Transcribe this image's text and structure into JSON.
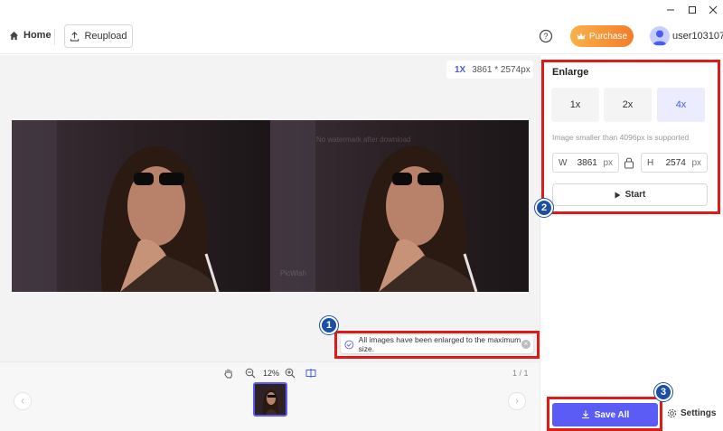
{
  "header": {
    "home_label": "Home",
    "reupload_label": "Reupload",
    "purchase_label": "Purchase",
    "username": "user103107"
  },
  "canvas": {
    "zoom_chip": "1X",
    "size_chip": "3861 * 2574px",
    "watermark_brand": "PicWish",
    "watermark_text": "No watermark after download"
  },
  "toast": {
    "message": "All images have been enlarged to the maximum size."
  },
  "toolbar": {
    "zoom_percent": "12%",
    "page_count": "1 / 1"
  },
  "panel": {
    "title": "Enlarge",
    "scales": [
      "1x",
      "2x",
      "4x"
    ],
    "selected_scale": "4x",
    "note": "Image smaller than 4096px is supported",
    "width_label": "W",
    "width_value": "3861",
    "height_label": "H",
    "height_value": "2574",
    "unit": "px",
    "start_label": "Start",
    "save_all_label": "Save All",
    "settings_label": "Settings"
  },
  "annotations": [
    "1",
    "2",
    "3"
  ],
  "colors": {
    "accent": "#5b5cf6",
    "highlight": "#e01919",
    "badge": "#1b4fa5"
  }
}
